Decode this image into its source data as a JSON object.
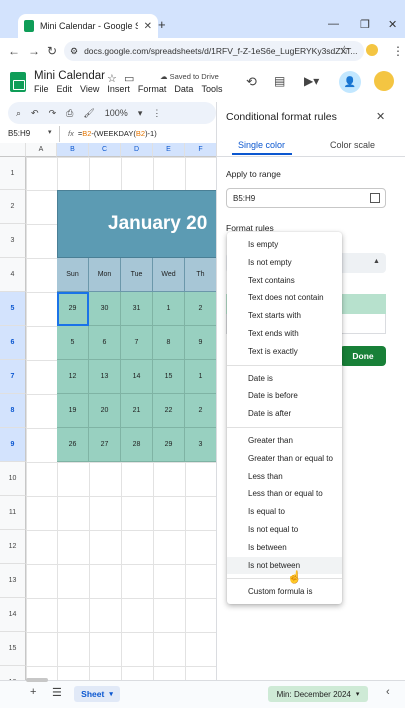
{
  "browser": {
    "tab_title": "Mini Calendar - Google Sheets",
    "tab_close": "✕",
    "new_tab": "+",
    "url": "docs.google.com/spreadsheets/d/1RFV_f-Z-1eS6e_LugERYKy3sdZXT...",
    "back": "←",
    "forward": "→",
    "reload": "↻",
    "star": "☆",
    "minimize": "—",
    "maximize": "❐",
    "close": "✕"
  },
  "sheets": {
    "title": "Mini Calendar",
    "saved": "Saved to Drive",
    "menus": [
      "File",
      "Edit",
      "View",
      "Insert",
      "Format",
      "Data",
      "Tools"
    ],
    "zoom": "100%",
    "name_box": "B5:H9",
    "formula_prefix": "=",
    "formula_ref1": "B2",
    "formula_mid": "-(WEEKDAY(",
    "formula_ref2": "B2",
    "formula_end": ")-1)"
  },
  "grid": {
    "columns": [
      "A",
      "B",
      "C",
      "D",
      "E",
      "F"
    ],
    "rows": [
      "1",
      "2",
      "3",
      "4",
      "5",
      "6",
      "7",
      "8",
      "9",
      "10",
      "11",
      "12",
      "13",
      "14",
      "15",
      "16"
    ],
    "banner_text": "January 20",
    "day_headers": [
      "Sun",
      "Mon",
      "Tue",
      "Wed",
      "Th"
    ],
    "weeks": [
      [
        "29",
        "30",
        "31",
        "1",
        "2"
      ],
      [
        "5",
        "6",
        "7",
        "8",
        "9"
      ],
      [
        "12",
        "13",
        "14",
        "15",
        "1"
      ],
      [
        "19",
        "20",
        "21",
        "22",
        "2"
      ],
      [
        "26",
        "27",
        "28",
        "29",
        "3"
      ]
    ]
  },
  "sidebar": {
    "title": "Conditional format rules",
    "close": "✕",
    "tab_single": "Single color",
    "tab_scale": "Color scale",
    "apply_label": "Apply to range",
    "range_value": "B5:H9",
    "format_rules_label": "Format rules",
    "done": "Done"
  },
  "dropdown": {
    "group1": [
      "Is empty",
      "Is not empty",
      "Text contains",
      "Text does not contain",
      "Text starts with",
      "Text ends with",
      "Text is exactly"
    ],
    "group2": [
      "Date is",
      "Date is before",
      "Date is after"
    ],
    "group3": [
      "Greater than",
      "Greater than or equal to",
      "Less than",
      "Less than or equal to",
      "Is equal to",
      "Is not equal to",
      "Is between",
      "Is not between"
    ],
    "group4": [
      "Custom formula is"
    ],
    "hovered": "Is not between"
  },
  "bottom": {
    "add": "+",
    "sheet_list": "☰",
    "sheet_name": "Sheet",
    "explore": "Min: December 2024",
    "collapse": "‹"
  },
  "colors": {
    "banner": "#5c9bb3",
    "day_header": "#a7c6d6",
    "day_cell": "#98d0c0",
    "accent": "#0b57d0",
    "done": "#188038"
  }
}
